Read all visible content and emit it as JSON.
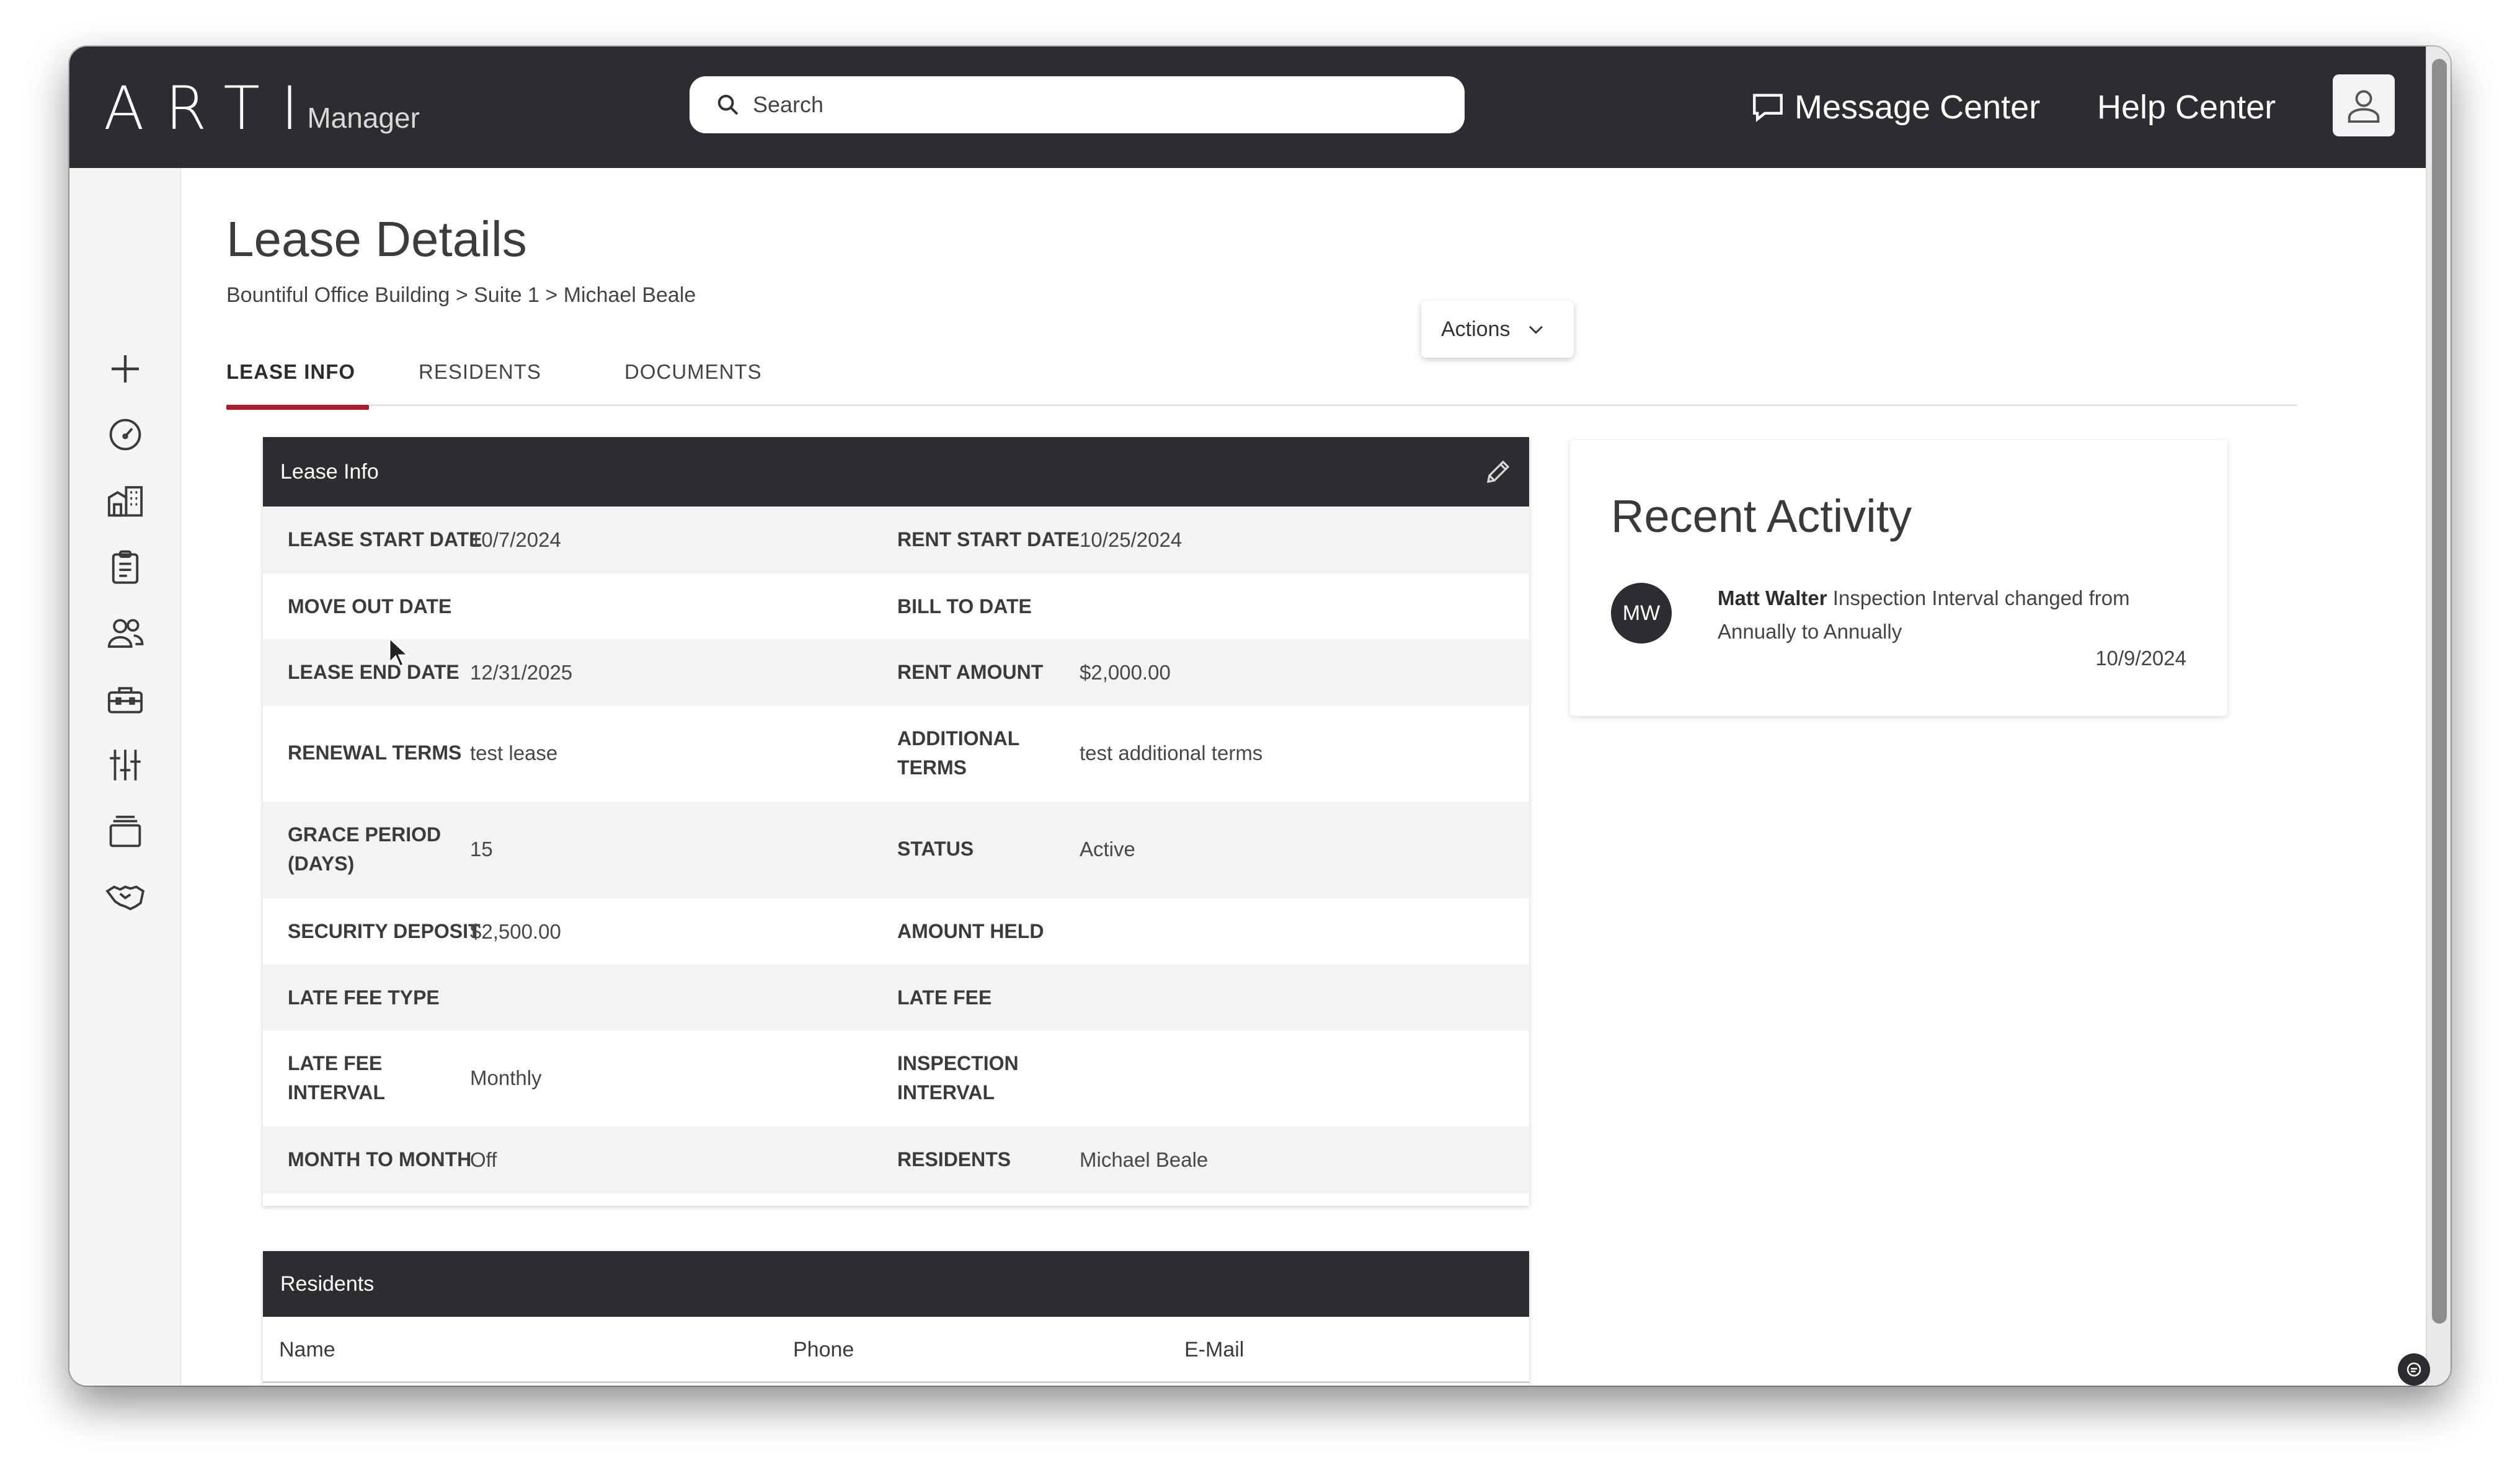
{
  "app": {
    "logo": "ARTI",
    "logo_sub": "Manager"
  },
  "topbar": {
    "search_placeholder": "Search",
    "message_center": "Message Center",
    "help_center": "Help Center"
  },
  "sidebar": {
    "items": [
      {
        "icon": "plus-icon"
      },
      {
        "icon": "dashboard-gauge-icon"
      },
      {
        "icon": "buildings-icon"
      },
      {
        "icon": "clipboard-icon"
      },
      {
        "icon": "people-icon"
      },
      {
        "icon": "toolbox-icon"
      },
      {
        "icon": "sliders-icon"
      },
      {
        "icon": "stack-icon"
      },
      {
        "icon": "handshake-icon"
      }
    ]
  },
  "page": {
    "title": "Lease Details",
    "breadcrumb": "Bountiful Office Building > Suite 1 > Michael Beale",
    "actions_label": "Actions",
    "tabs": [
      {
        "label": "LEASE INFO",
        "active": true
      },
      {
        "label": "RESIDENTS",
        "active": false
      },
      {
        "label": "DOCUMENTS",
        "active": false
      }
    ]
  },
  "lease_info": {
    "header": "Lease Info",
    "rows": [
      {
        "l1": "LEASE START DATE",
        "v1": "10/7/2024",
        "l2": "RENT START DATE",
        "v2": "10/25/2024"
      },
      {
        "l1": "MOVE OUT DATE",
        "v1": "",
        "l2": "BILL TO DATE",
        "v2": ""
      },
      {
        "l1": "LEASE END DATE",
        "v1": "12/31/2025",
        "l2": "RENT AMOUNT",
        "v2": "$2,000.00"
      },
      {
        "l1": "RENEWAL TERMS",
        "v1": "test lease",
        "l2a": "ADDITIONAL",
        "l2b": "TERMS",
        "v2": "test additional terms"
      },
      {
        "l1a": "GRACE PERIOD",
        "l1b": "(DAYS)",
        "v1": "15",
        "l2": "STATUS",
        "v2": "Active"
      },
      {
        "l1": "SECURITY DEPOSIT",
        "v1": "$2,500.00",
        "l2": "AMOUNT HELD",
        "v2": ""
      },
      {
        "l1": "LATE FEE TYPE",
        "v1": "",
        "l2": "LATE FEE",
        "v2": ""
      },
      {
        "l1a": "LATE FEE",
        "l1b": "INTERVAL",
        "v1": "Monthly",
        "l2a": "INSPECTION",
        "l2b": "INTERVAL",
        "v2": ""
      },
      {
        "l1": "MONTH TO MONTH",
        "v1": "Off",
        "l2": "RESIDENTS",
        "v2": "Michael Beale"
      }
    ]
  },
  "activity": {
    "title": "Recent Activity",
    "entries": [
      {
        "initials": "MW",
        "user": "Matt Walter",
        "text": " Inspection Interval changed from Annually to Annually",
        "date": "10/9/2024"
      }
    ]
  },
  "residents": {
    "header": "Residents",
    "columns": [
      "Name",
      "Phone",
      "E-Mail"
    ]
  },
  "colors": {
    "topbar": "#2b2d31",
    "tab_accent": "#a31d2b"
  }
}
